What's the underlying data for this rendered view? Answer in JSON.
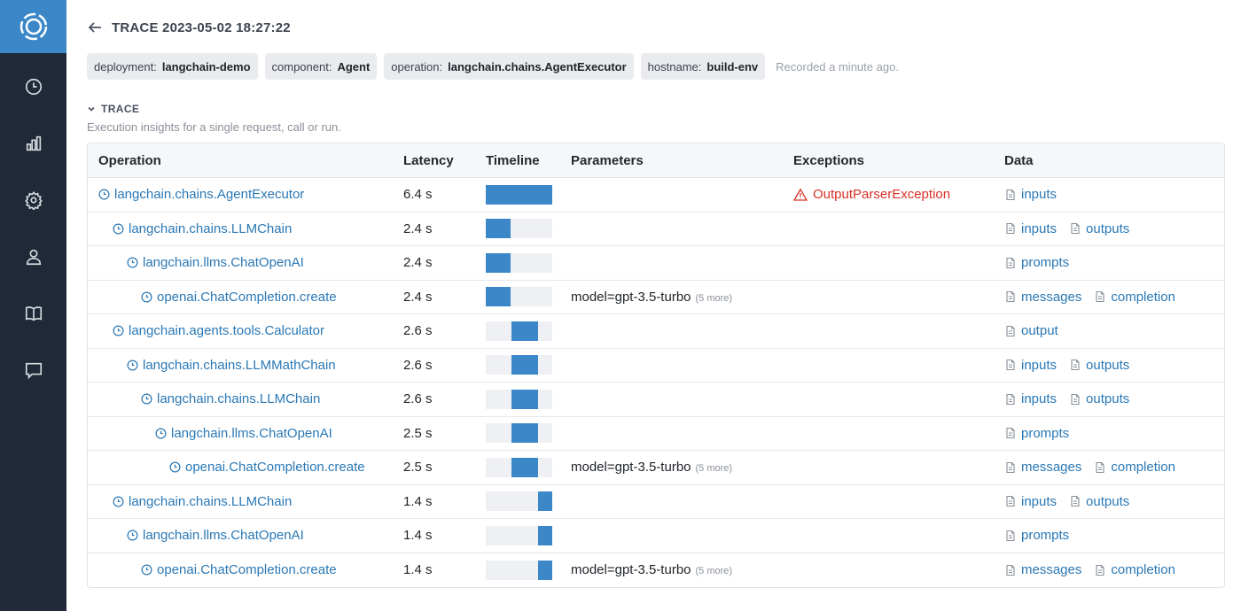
{
  "app": {
    "title": "TRACE 2023-05-02 18:27:22",
    "logo_icon": "openllmetry-logo",
    "accent_color": "#3b87c8",
    "sidebar_color": "#1f2937"
  },
  "sidebar": {
    "items": [
      {
        "icon": "clock-icon"
      },
      {
        "icon": "bar-chart-icon"
      },
      {
        "icon": "gear-icon"
      },
      {
        "icon": "user-icon"
      },
      {
        "icon": "book-icon"
      },
      {
        "icon": "chat-icon"
      }
    ]
  },
  "tags": [
    {
      "key": "deployment:",
      "value": "langchain-demo"
    },
    {
      "key": "component:",
      "value": "Agent"
    },
    {
      "key": "operation:",
      "value": "langchain.chains.AgentExecutor"
    },
    {
      "key": "hostname:",
      "value": "build-env"
    }
  ],
  "recorded": "Recorded a minute ago.",
  "section": {
    "title": "TRACE",
    "subtitle": "Execution insights for a single request, call or run."
  },
  "table": {
    "headers": [
      "Operation",
      "Latency",
      "Timeline",
      "Parameters",
      "Exceptions",
      "Data"
    ],
    "rows": [
      {
        "operation": "langchain.chains.AgentExecutor",
        "depth": 0,
        "latency": "6.4 s",
        "timeline": {
          "start": 0.0,
          "end": 1.0
        },
        "parameter": "",
        "more": "",
        "exception": "OutputParserException",
        "data": [
          "inputs"
        ]
      },
      {
        "operation": "langchain.chains.LLMChain",
        "depth": 1,
        "latency": "2.4 s",
        "timeline": {
          "start": 0.0,
          "end": 0.375
        },
        "parameter": "",
        "more": "",
        "exception": "",
        "data": [
          "inputs",
          "outputs"
        ]
      },
      {
        "operation": "langchain.llms.ChatOpenAI",
        "depth": 2,
        "latency": "2.4 s",
        "timeline": {
          "start": 0.0,
          "end": 0.375
        },
        "parameter": "",
        "more": "",
        "exception": "",
        "data": [
          "prompts"
        ]
      },
      {
        "operation": "openai.ChatCompletion.create",
        "depth": 3,
        "latency": "2.4 s",
        "timeline": {
          "start": 0.0,
          "end": 0.375
        },
        "parameter": "model=gpt-3.5-turbo",
        "more": "(5 more)",
        "exception": "",
        "data": [
          "messages",
          "completion"
        ]
      },
      {
        "operation": "langchain.agents.tools.Calculator",
        "depth": 1,
        "latency": "2.6 s",
        "timeline": {
          "start": 0.39,
          "end": 0.78
        },
        "parameter": "",
        "more": "",
        "exception": "",
        "data": [
          "output"
        ]
      },
      {
        "operation": "langchain.chains.LLMMathChain",
        "depth": 2,
        "latency": "2.6 s",
        "timeline": {
          "start": 0.39,
          "end": 0.78
        },
        "parameter": "",
        "more": "",
        "exception": "",
        "data": [
          "inputs",
          "outputs"
        ]
      },
      {
        "operation": "langchain.chains.LLMChain",
        "depth": 3,
        "latency": "2.6 s",
        "timeline": {
          "start": 0.39,
          "end": 0.78
        },
        "parameter": "",
        "more": "",
        "exception": "",
        "data": [
          "inputs",
          "outputs"
        ]
      },
      {
        "operation": "langchain.llms.ChatOpenAI",
        "depth": 4,
        "latency": "2.5 s",
        "timeline": {
          "start": 0.39,
          "end": 0.78
        },
        "parameter": "",
        "more": "",
        "exception": "",
        "data": [
          "prompts"
        ]
      },
      {
        "operation": "openai.ChatCompletion.create",
        "depth": 5,
        "latency": "2.5 s",
        "timeline": {
          "start": 0.39,
          "end": 0.78
        },
        "parameter": "model=gpt-3.5-turbo",
        "more": "(5 more)",
        "exception": "",
        "data": [
          "messages",
          "completion"
        ]
      },
      {
        "operation": "langchain.chains.LLMChain",
        "depth": 1,
        "latency": "1.4 s",
        "timeline": {
          "start": 0.78,
          "end": 1.0
        },
        "parameter": "",
        "more": "",
        "exception": "",
        "data": [
          "inputs",
          "outputs"
        ]
      },
      {
        "operation": "langchain.llms.ChatOpenAI",
        "depth": 2,
        "latency": "1.4 s",
        "timeline": {
          "start": 0.78,
          "end": 1.0
        },
        "parameter": "",
        "more": "",
        "exception": "",
        "data": [
          "prompts"
        ]
      },
      {
        "operation": "openai.ChatCompletion.create",
        "depth": 3,
        "latency": "1.4 s",
        "timeline": {
          "start": 0.78,
          "end": 1.0
        },
        "parameter": "model=gpt-3.5-turbo",
        "more": "(5 more)",
        "exception": "",
        "data": [
          "messages",
          "completion"
        ]
      }
    ]
  }
}
